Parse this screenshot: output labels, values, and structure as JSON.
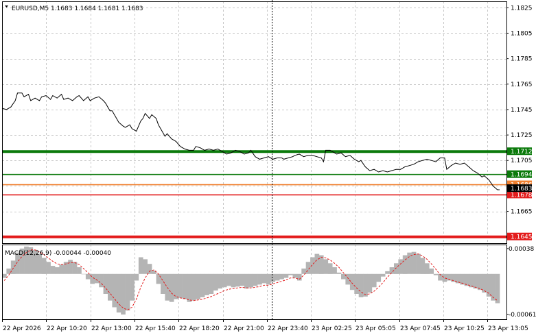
{
  "window": {
    "header_text": "EURUSD,M5  1.1683 1.1684 1.1681 1.1683",
    "macd_header": "MACD(12,26,9) -0.00044 -0.00040"
  },
  "chart_data": [
    {
      "type": "line",
      "title": "EURUSD,M5",
      "symbol": "EURUSD",
      "timeframe": "M5",
      "ohlc": {
        "open": 1.1683,
        "high": 1.1684,
        "low": 1.1681,
        "close": 1.1683
      },
      "ylim": [
        1.164,
        1.183
      ],
      "y_ticks": [
        "1.1825",
        "1.1805",
        "1.1785",
        "1.1765",
        "1.1745",
        "1.1725",
        "1.1705",
        "1.1685",
        "1.1665",
        "1.1645"
      ],
      "x_ticks": [
        "22 Apr 2026",
        "22 Apr 10:20",
        "22 Apr 13:00",
        "22 Apr 15:40",
        "22 Apr 18:20",
        "22 Apr 21:00",
        "22 Apr 23:40",
        "23 Apr 02:25",
        "23 Apr 05:05",
        "23 Apr 07:45",
        "23 Apr 10:25",
        "23 Apr 13:05"
      ],
      "grid": true,
      "line_color": "#000000",
      "current_price": 1.1683,
      "levels": [
        {
          "label": "1.1712",
          "value": 1.1712,
          "color": "#0b7a0b",
          "thick": true
        },
        {
          "label": "1.1694",
          "value": 1.1694,
          "color": "#0b7a0b",
          "thick": false
        },
        {
          "label": "1.1686",
          "value": 1.1686,
          "color": "#f08030",
          "thick": false
        },
        {
          "label": "1.1678",
          "value": 1.1678,
          "color": "#e31b1b",
          "thick": false
        },
        {
          "label": "1.1645",
          "value": 1.1645,
          "color": "#e31b1b",
          "thick": true
        }
      ],
      "points": [
        [
          0,
          1.1746
        ],
        [
          2,
          1.1745
        ],
        [
          4,
          1.1747
        ],
        [
          6,
          1.1752
        ],
        [
          7,
          1.1758
        ],
        [
          9,
          1.1758
        ],
        [
          10,
          1.1755
        ],
        [
          12,
          1.1757
        ],
        [
          13,
          1.1752
        ],
        [
          15,
          1.1754
        ],
        [
          17,
          1.1752
        ],
        [
          18,
          1.1755
        ],
        [
          20,
          1.1756
        ],
        [
          22,
          1.1753
        ],
        [
          23,
          1.1756
        ],
        [
          25,
          1.1754
        ],
        [
          27,
          1.1757
        ],
        [
          28,
          1.1753
        ],
        [
          30,
          1.1754
        ],
        [
          32,
          1.1752
        ],
        [
          34,
          1.1755
        ],
        [
          35,
          1.1756
        ],
        [
          37,
          1.1752
        ],
        [
          39,
          1.1755
        ],
        [
          40,
          1.1752
        ],
        [
          42,
          1.1754
        ],
        [
          44,
          1.1755
        ],
        [
          46,
          1.1752
        ],
        [
          47,
          1.175
        ],
        [
          49,
          1.1744
        ],
        [
          50,
          1.1744
        ],
        [
          52,
          1.1738
        ],
        [
          53,
          1.1735
        ],
        [
          55,
          1.1732
        ],
        [
          56,
          1.1731
        ],
        [
          58,
          1.1733
        ],
        [
          59,
          1.173
        ],
        [
          61,
          1.1728
        ],
        [
          62,
          1.1732
        ],
        [
          63,
          1.1736
        ],
        [
          64,
          1.1738
        ],
        [
          65,
          1.1742
        ],
        [
          67,
          1.1738
        ],
        [
          68,
          1.1741
        ],
        [
          70,
          1.1738
        ],
        [
          71,
          1.1733
        ],
        [
          72,
          1.173
        ],
        [
          74,
          1.1724
        ],
        [
          75,
          1.1726
        ],
        [
          77,
          1.1722
        ],
        [
          79,
          1.172
        ],
        [
          81,
          1.1716
        ],
        [
          83,
          1.1714
        ],
        [
          85,
          1.1713
        ],
        [
          87,
          1.1713
        ],
        [
          88,
          1.1716
        ],
        [
          90,
          1.1715
        ],
        [
          92,
          1.1713
        ],
        [
          94,
          1.1714
        ],
        [
          96,
          1.1713
        ],
        [
          98,
          1.1714
        ],
        [
          100,
          1.1712
        ],
        [
          102,
          1.171
        ],
        [
          104,
          1.1711
        ],
        [
          106,
          1.1713
        ],
        [
          108,
          1.1712
        ],
        [
          110,
          1.171
        ],
        [
          112,
          1.1711
        ],
        [
          113,
          1.1713
        ],
        [
          115,
          1.1708
        ],
        [
          117,
          1.1706
        ],
        [
          119,
          1.1707
        ],
        [
          121,
          1.1708
        ],
        [
          123,
          1.1706
        ],
        [
          125,
          1.1707
        ],
        [
          127,
          1.1707
        ],
        [
          128,
          1.1706
        ],
        [
          130,
          1.1707
        ],
        [
          132,
          1.1708
        ],
        [
          133,
          1.1709
        ],
        [
          135,
          1.171
        ],
        [
          137,
          1.1708
        ],
        [
          139,
          1.1709
        ],
        [
          141,
          1.1709
        ],
        [
          143,
          1.1708
        ],
        [
          145,
          1.1707
        ],
        [
          146,
          1.1704
        ],
        [
          147,
          1.1713
        ],
        [
          149,
          1.1713
        ],
        [
          150,
          1.1712
        ],
        [
          152,
          1.171
        ],
        [
          154,
          1.1711
        ],
        [
          156,
          1.1708
        ],
        [
          158,
          1.1709
        ],
        [
          160,
          1.1706
        ],
        [
          162,
          1.1704
        ],
        [
          163,
          1.1705
        ],
        [
          165,
          1.17
        ],
        [
          167,
          1.1697
        ],
        [
          169,
          1.1698
        ],
        [
          171,
          1.1696
        ],
        [
          173,
          1.1697
        ],
        [
          175,
          1.1696
        ],
        [
          177,
          1.1697
        ],
        [
          179,
          1.1698
        ],
        [
          181,
          1.1698
        ],
        [
          183,
          1.17
        ],
        [
          185,
          1.1701
        ],
        [
          187,
          1.1702
        ],
        [
          189,
          1.1704
        ],
        [
          191,
          1.1705
        ],
        [
          193,
          1.1706
        ],
        [
          195,
          1.1705
        ],
        [
          197,
          1.1704
        ],
        [
          199,
          1.1707
        ],
        [
          201,
          1.1707
        ],
        [
          202,
          1.1698
        ],
        [
          204,
          1.1701
        ],
        [
          206,
          1.1703
        ],
        [
          208,
          1.1702
        ],
        [
          210,
          1.1703
        ],
        [
          212,
          1.17
        ],
        [
          214,
          1.1697
        ],
        [
          216,
          1.1695
        ],
        [
          218,
          1.1692
        ],
        [
          219,
          1.1693
        ],
        [
          221,
          1.169
        ],
        [
          223,
          1.1685
        ],
        [
          225,
          1.1682
        ],
        [
          226,
          1.1682
        ]
      ]
    },
    {
      "type": "bar",
      "title": "MACD(12,26,9)",
      "macd_value": -0.00044,
      "signal_value": -0.0004,
      "ylim": [
        -0.00068,
        0.00044
      ],
      "y_ticks": [
        "0.00038",
        "-0.00061"
      ],
      "bar_color": "#b4b4b4",
      "signal_color": "#e31b1b",
      "histogram": [
        -6e-05,
        8e-05,
        0.0002,
        0.00032,
        0.00038,
        0.00041,
        0.0004,
        0.00036,
        0.0003,
        0.00024,
        0.00018,
        0.00012,
        0.0001,
        0.00014,
        0.00018,
        0.00021,
        0.00018,
        0.0001,
        0.0,
        -8e-05,
        -0.00015,
        -0.00014,
        -0.0002,
        -0.0003,
        -0.0004,
        -0.0005,
        -0.00058,
        -0.00061,
        -0.00055,
        -0.0004,
        -0.0001,
        0.00025,
        0.00022,
        0.00015,
        5e-05,
        -0.00015,
        -0.0003,
        -0.0004,
        -0.00042,
        -0.00038,
        -0.00036,
        -0.00038,
        -0.00042,
        -0.0004,
        -0.00038,
        -0.00035,
        -0.00032,
        -0.0003,
        -0.00025,
        -0.00022,
        -0.0002,
        -0.00018,
        -0.0002,
        -0.00019,
        -0.00018,
        -0.00022,
        -0.0002,
        -0.00018,
        -0.00016,
        -0.00014,
        -0.00016,
        -0.00012,
        -0.0001,
        -8e-05,
        -6e-05,
        -2e-05,
        -6e-05,
        -0.0001,
        8e-05,
        0.00018,
        0.00025,
        0.0003,
        0.00028,
        0.00022,
        0.00016,
        0.0001,
        2e-05,
        -8e-05,
        -0.00016,
        -0.00024,
        -0.0003,
        -0.00035,
        -0.00034,
        -0.00028,
        -0.0002,
        -0.00012,
        -4e-05,
        4e-05,
        0.0001,
        0.00016,
        0.00022,
        0.00028,
        0.00032,
        0.00033,
        0.0003,
        0.00024,
        0.00016,
        8e-05,
        -2e-05,
        -0.0001,
        -0.00012,
        -0.0001,
        -0.00012,
        -0.00014,
        -0.00016,
        -0.00018,
        -0.0002,
        -0.00022,
        -0.00024,
        -0.00028,
        -0.00034,
        -0.0004,
        -0.00044
      ],
      "signal": [
        -0.0001,
        -2e-05,
        8e-05,
        0.00018,
        0.00026,
        0.00032,
        0.00036,
        0.00036,
        0.00033,
        0.00029,
        0.00024,
        0.00019,
        0.00015,
        0.00014,
        0.00015,
        0.00017,
        0.00017,
        0.00014,
        8e-05,
        2e-05,
        -5e-05,
        -9e-05,
        -0.00014,
        -0.00021,
        -0.00029,
        -0.00037,
        -0.00045,
        -0.00051,
        -0.00054,
        -0.0005,
        -0.00038,
        -0.0002,
        -6e-05,
        4e-05,
        6e-05,
        0.0,
        -0.0001,
        -0.0002,
        -0.00029,
        -0.00034,
        -0.00036,
        -0.00037,
        -0.00039,
        -0.0004,
        -0.00039,
        -0.00038,
        -0.00036,
        -0.00034,
        -0.00031,
        -0.00028,
        -0.00025,
        -0.00023,
        -0.00022,
        -0.00021,
        -0.0002,
        -0.00021,
        -0.00021,
        -0.0002,
        -0.00019,
        -0.00017,
        -0.00017,
        -0.00015,
        -0.00013,
        -0.00011,
        -9e-05,
        -6e-05,
        -6e-05,
        -8e-05,
        -2e-05,
        6e-05,
        0.00014,
        0.00021,
        0.00025,
        0.00024,
        0.00021,
        0.00016,
        0.0001,
        2e-05,
        -6e-05,
        -0.00014,
        -0.00021,
        -0.00027,
        -0.00031,
        -0.0003,
        -0.00026,
        -0.0002,
        -0.00013,
        -5e-05,
        2e-05,
        9e-05,
        0.00015,
        0.00021,
        0.00026,
        0.00029,
        0.0003,
        0.00027,
        0.00022,
        0.00015,
        7e-05,
        -1e-05,
        -6e-05,
        -8e-05,
        -0.0001,
        -0.00012,
        -0.00014,
        -0.00016,
        -0.00018,
        -0.0002,
        -0.00022,
        -0.00025,
        -0.00029,
        -0.00035,
        -0.0004
      ]
    }
  ]
}
